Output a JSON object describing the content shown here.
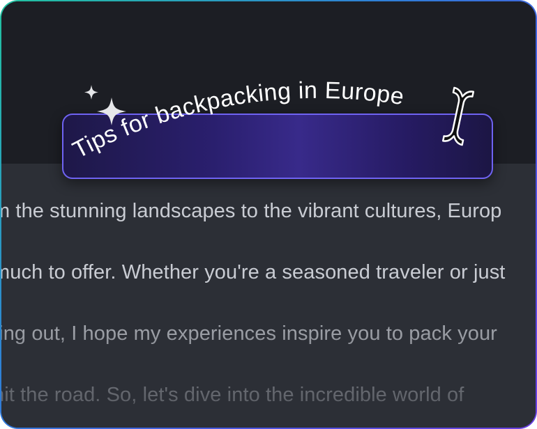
{
  "prompt": {
    "text": "Tips for backpacking in Europe"
  },
  "body": {
    "lines": [
      "m the stunning landscapes to the vibrant cultures, Europ",
      "much to offer. Whether you're a seasoned traveler or just",
      "ting out, I hope my experiences inspire you to pack your",
      "hit the road. So, let's dive into the incredible world of"
    ]
  },
  "icons": {
    "sparkle": "sparkle-icon",
    "cursor": "text-cursor-icon"
  },
  "colors": {
    "accent": "#6f63f2",
    "background": "#1c1e24",
    "text": "#c9ccd3"
  }
}
